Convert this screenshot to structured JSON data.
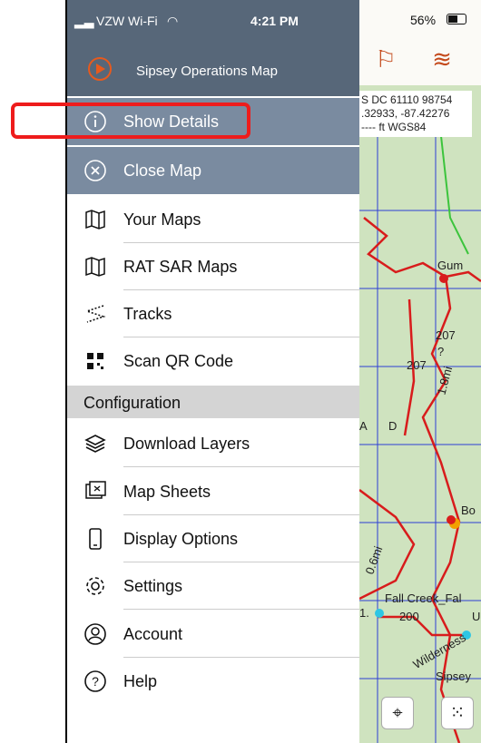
{
  "status_bar": {
    "carrier": "VZW Wi-Fi",
    "time": "4:21 PM",
    "battery": "56%"
  },
  "app": {
    "title": "Sipsey Operations Map"
  },
  "menu": {
    "show_details": "Show Details",
    "close_map": "Close Map",
    "items": [
      "Your Maps",
      "RAT SAR Maps",
      "Tracks",
      "Scan QR Code"
    ],
    "section_title": "Configuration",
    "config_items": [
      "Download Layers",
      "Map Sheets",
      "Display Options",
      "Settings",
      "Account",
      "Help"
    ]
  },
  "map": {
    "coords": [
      "S DC 61110 98754",
      ".32933, -87.42276",
      "---- ft  WGS84"
    ],
    "labels": {
      "gum": "Gum",
      "r207a": "207",
      "r207b": "207",
      "r18": "1.8mi",
      "q": "?",
      "bo": "Bo",
      "falls": "Fall  Creek_Fal",
      "r200": "200",
      "sipsey": "Sipsey",
      "wild": "Wilderness",
      "r06": "0.6mi",
      "r1": "1.",
      "a": "A",
      "d": "D",
      "u": "U"
    }
  },
  "colors": {
    "drawer_header": "#576779",
    "selected_row": "#7a8ba0",
    "highlight": "#ee1c1c",
    "map_accent": "#c44a1c"
  }
}
